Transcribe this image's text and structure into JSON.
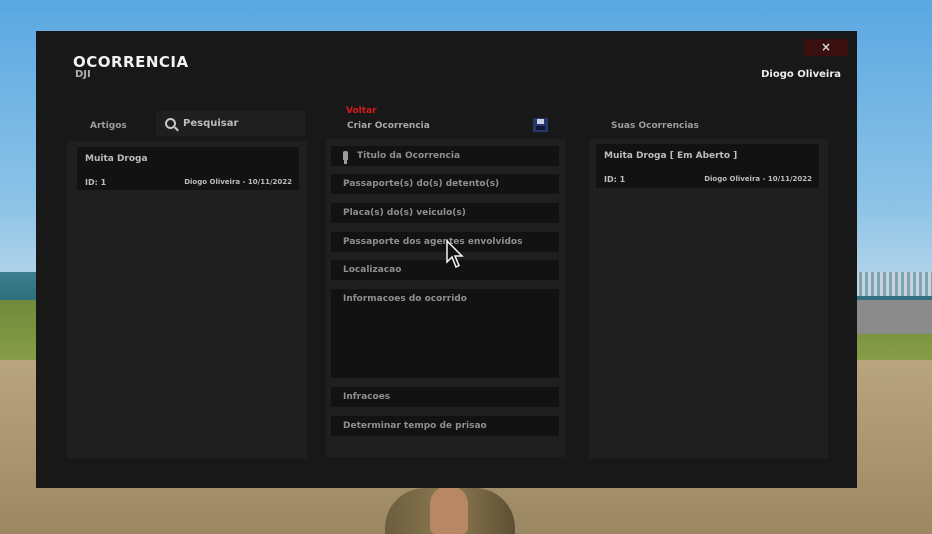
{
  "window": {
    "title": "OCORRENCIA",
    "subtitle": "DJI",
    "close_label": "×",
    "user_name": "Diogo Oliveira"
  },
  "left": {
    "tab_label": "Artigos",
    "search_placeholder": "Pesquisar",
    "items": [
      {
        "title": "Muita Droga",
        "id": "ID: 1",
        "meta": "Diogo Oliveira - 10/11/2022"
      }
    ]
  },
  "middle": {
    "back_label": "Voltar",
    "header": "Criar Ocorrencia",
    "fields": {
      "titulo": "Titulo da Ocorrencia",
      "detentos": "Passaporte(s) do(s) detento(s)",
      "placas": "Placa(s) do(s) veiculo(s)",
      "agentes": "Passaporte dos agentes envolvidos",
      "localizacao": "Localizacao",
      "informacoes": "Informacoes do ocorrido",
      "infracoes": "Infracoes",
      "tempo": "Determinar tempo de prisao"
    }
  },
  "right": {
    "header": "Suas Ocorrencias",
    "items": [
      {
        "title": "Muita Droga [ Em Aberto ]",
        "id": "ID: 1",
        "meta": "Diogo Oliveira - 10/11/2022"
      }
    ]
  },
  "colors": {
    "panel": "#181818",
    "column": "#1f1f1f",
    "field": "#121212",
    "accent_red": "#d91818"
  }
}
